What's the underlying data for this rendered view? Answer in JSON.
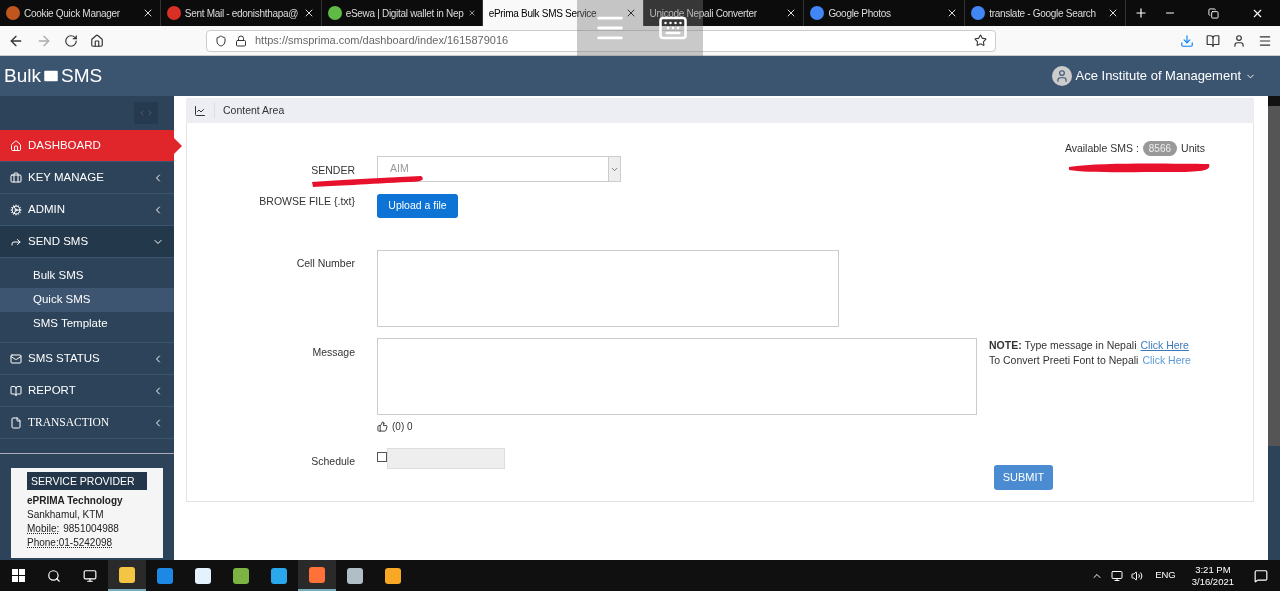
{
  "browser": {
    "tabs": [
      {
        "title": "Cookie Quick Manager",
        "kind": "cookie",
        "selected": false
      },
      {
        "title": "Sent Mail - edonishthapa@",
        "kind": "mail",
        "selected": false
      },
      {
        "title": "eSewa | Digital wallet in Nep",
        "kind": "wallet",
        "selected": false
      },
      {
        "title": "ePrima Bulk SMS Service",
        "kind": "plain",
        "selected": true
      },
      {
        "title": "Unicode Nepali Converter",
        "kind": "plain",
        "selected": false
      },
      {
        "title": "Google Photos",
        "kind": "google",
        "selected": false
      },
      {
        "title": "translate - Google Search",
        "kind": "google",
        "selected": false
      }
    ],
    "url": "https://smsprima.com/dashboard/index/1615879016"
  },
  "header": {
    "brand_left": "Bulk",
    "brand_right": "SMS",
    "user": "Ace Institute of Management"
  },
  "sidebar": {
    "items": [
      {
        "label": "DASHBOARD",
        "kind": "home",
        "selected": true,
        "expandable": false,
        "expanded": false
      },
      {
        "label": "KEY MANAGE",
        "kind": "briefcase",
        "selected": false,
        "expandable": true,
        "expanded": false
      },
      {
        "label": "ADMIN",
        "kind": "gears",
        "selected": false,
        "expandable": true,
        "expanded": false
      },
      {
        "label": "SEND SMS",
        "kind": "share",
        "selected": false,
        "expandable": true,
        "expanded": true,
        "children": [
          {
            "label": "Bulk SMS",
            "selected": false
          },
          {
            "label": "Quick SMS",
            "selected": true
          },
          {
            "label": "SMS Template",
            "selected": false
          }
        ]
      },
      {
        "label": "SMS STATUS",
        "kind": "envelope",
        "selected": false,
        "expandable": true,
        "expanded": false
      },
      {
        "label": "REPORT",
        "kind": "book",
        "selected": false,
        "expandable": true,
        "expanded": false
      },
      {
        "label": "TRANSACTION",
        "kind": "file",
        "selected": false,
        "expandable": true,
        "expanded": false
      }
    ],
    "provider": {
      "title": "SERVICE PROVIDER",
      "name": "ePRIMA Technology",
      "address": "Sankhamul, KTM",
      "mobile_label": "Mobile:",
      "mobile": "9851004988",
      "phone": "Phone:01-5242098"
    }
  },
  "content": {
    "title": "Content Area",
    "available": {
      "label": "Available SMS :",
      "count": "8566",
      "unit": "Units"
    },
    "form": {
      "sender_label": "SENDER",
      "sender_value": "AIM",
      "browse_label": "BROWSE FILE {.txt}",
      "upload_button": "Upload a file",
      "cell_label": "Cell Number",
      "message_label": "Message",
      "counter": "(0) 0",
      "note_lines": [
        {
          "text": "**NOTE:** Type message in Nepali",
          "link": "Click Here",
          "visited": true
        },
        {
          "text": "To Convert Preeti Font to Nepali",
          "link": "Click Here",
          "visited": false
        }
      ],
      "schedule_label": "Schedule",
      "schedule_checked": false,
      "submit": "SUBMIT"
    }
  },
  "taskbar": {
    "apps": [
      {
        "kind": "explorer",
        "active": true
      },
      {
        "kind": "edge",
        "active": false
      },
      {
        "kind": "store",
        "active": false
      },
      {
        "kind": "notepad",
        "active": false
      },
      {
        "kind": "telegram",
        "active": false
      },
      {
        "kind": "firefox",
        "active": true
      },
      {
        "kind": "drive",
        "active": false
      },
      {
        "kind": "dollar",
        "active": false
      }
    ],
    "language": "ENG",
    "time": "3:21 PM",
    "date": "3/16/2021"
  }
}
